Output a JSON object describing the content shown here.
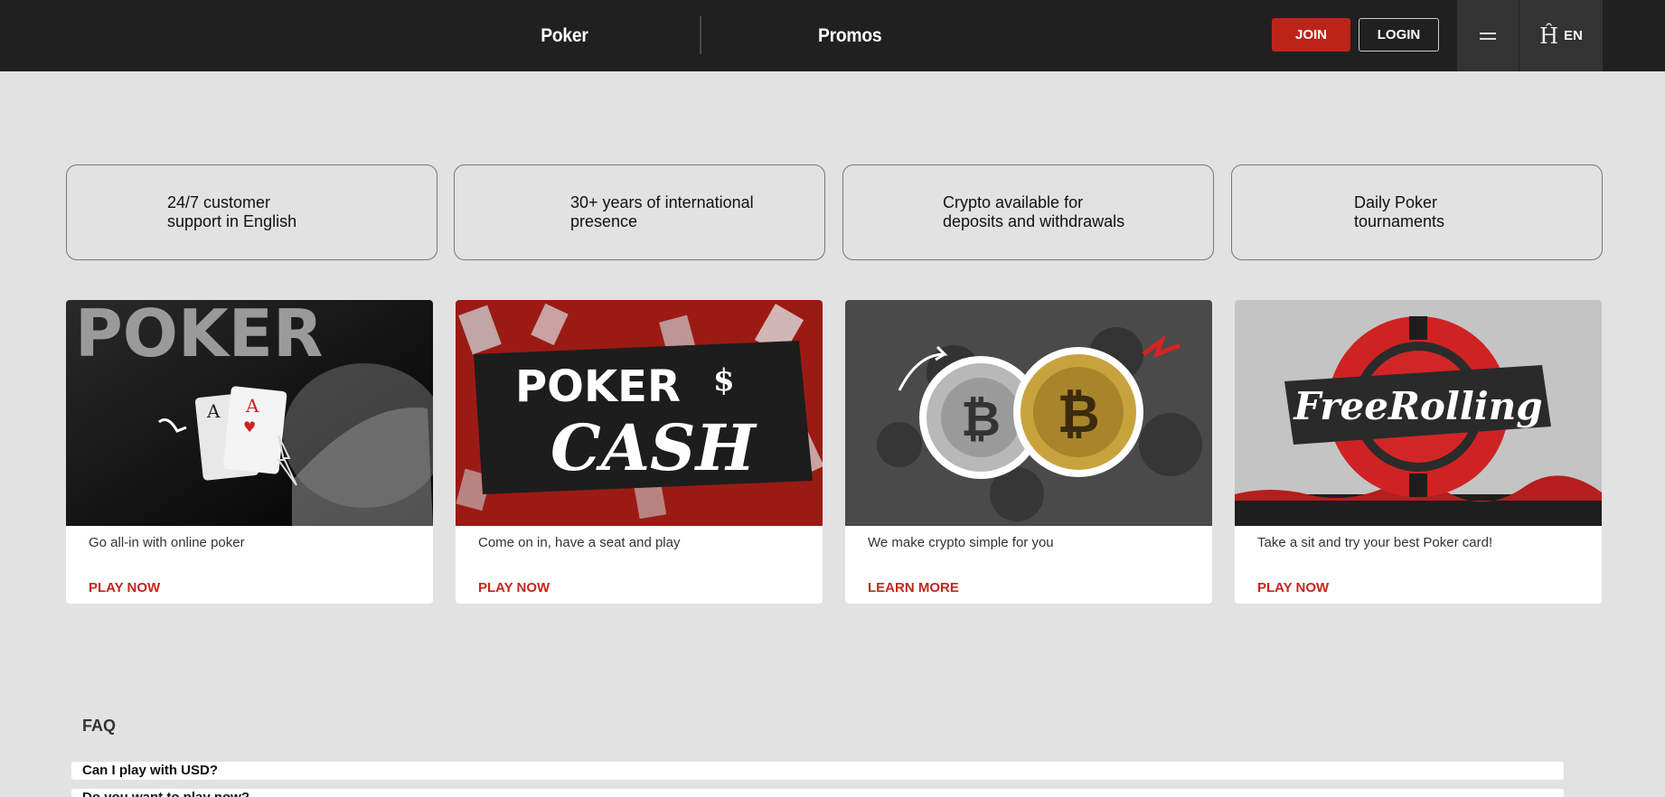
{
  "header": {
    "nav": [
      {
        "label": "Poker"
      },
      {
        "label": "Promos"
      }
    ],
    "join_label": "JOIN",
    "login_label": "LOGIN",
    "language": "EN"
  },
  "features": [
    {
      "text": "24/7 customer\nsupport in English"
    },
    {
      "text": "30+ years of international\npresence"
    },
    {
      "text": "Crypto available for\ndeposits and withdrawals"
    },
    {
      "text": "Daily Poker\ntournaments"
    }
  ],
  "cards": [
    {
      "image_text": "POKER",
      "description": "Go all-in with online poker",
      "cta": "PLAY NOW"
    },
    {
      "image_text_top": "POKER",
      "image_text_bottom": "CASH",
      "description": "Come on in, have a seat and play",
      "cta": "PLAY NOW"
    },
    {
      "description": "We make crypto simple for you",
      "cta": "LEARN MORE"
    },
    {
      "image_text": "FreeRolling",
      "description": "Take a sit and try your best Poker card!",
      "cta": "PLAY NOW"
    }
  ],
  "faq": {
    "title": "FAQ",
    "items": [
      {
        "question": "Can I play with USD?"
      },
      {
        "question": "Do you want to play now?"
      }
    ]
  },
  "colors": {
    "header_bg": "#202020",
    "page_bg": "#e2e2e2",
    "accent_red": "#bd2419",
    "cta_red": "#c7261b"
  }
}
